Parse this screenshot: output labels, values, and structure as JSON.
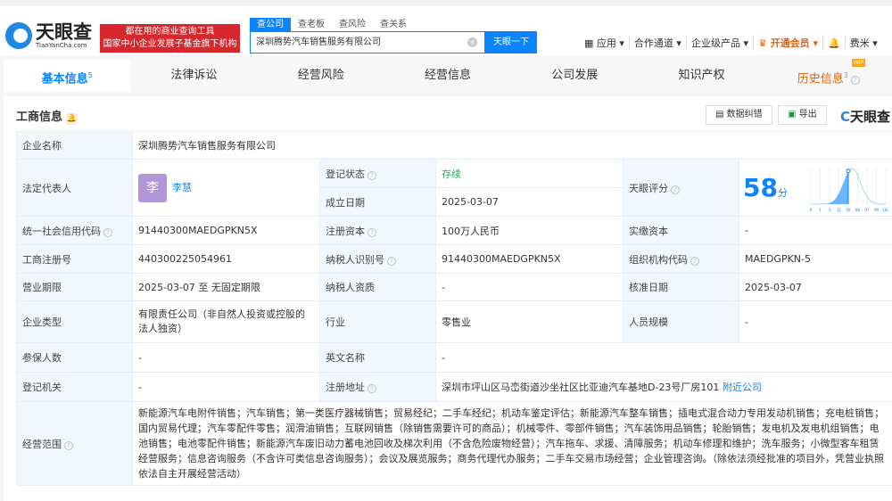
{
  "header": {
    "logo_cn": "天眼查",
    "logo_en": "TianYanCha.com",
    "slogan_1": "都在用的商业查询工具",
    "slogan_2": "国家中小企业发展子基金旗下机构",
    "search_tabs": [
      "查公司",
      "查老板",
      "查风险",
      "查关系"
    ],
    "search_value": "深圳腾势汽车销售服务有限公司",
    "search_button": "天眼一下",
    "nav": [
      "应用",
      "合作通道",
      "企业级产品",
      "开通会员",
      "费米"
    ]
  },
  "tabs": [
    {
      "label": "基本信息",
      "count": "5"
    },
    {
      "label": "法律诉讼"
    },
    {
      "label": "经营风险"
    },
    {
      "label": "经营信息"
    },
    {
      "label": "公司发展"
    },
    {
      "label": "知识产权"
    },
    {
      "label": "历史信息",
      "count": "3",
      "badge": "WIP"
    }
  ],
  "section": {
    "title": "工商信息",
    "report_error": "数据纠错",
    "export": "导出",
    "brand": "天眼查"
  },
  "info": {
    "company_name_label": "企业名称",
    "company_name": "深圳腾势汽车销售服务有限公司",
    "legal_rep_label": "法定代表人",
    "legal_rep_avatar": "李",
    "legal_rep": "李慧",
    "status_label": "登记状态",
    "status": "存续",
    "founded_label": "成立日期",
    "founded": "2025-03-07",
    "score_label": "天眼评分",
    "score": "58",
    "score_unit": "分",
    "credit_code_label": "统一社会信用代码",
    "credit_code": "91440300MAEDGPKN5X",
    "capital_label": "注册资本",
    "capital": "100万人民币",
    "paid_label": "实缴资本",
    "paid": "-",
    "reg_no_label": "工商注册号",
    "reg_no": "440300225054961",
    "taxpayer_id_label": "纳税人识别号",
    "taxpayer_id": "91440300MAEDGPKN5X",
    "org_code_label": "组织机构代码",
    "org_code": "MAEDGPKN-5",
    "term_label": "营业期限",
    "term": "2025-03-07 至 无固定期限",
    "taxpayer_qual_label": "纳税人资质",
    "taxpayer_qual": "-",
    "approve_label": "核准日期",
    "approve": "2025-03-07",
    "type_label": "企业类型",
    "type": "有限责任公司（非自然人投资或控股的法人独资）",
    "industry_label": "行业",
    "industry": "零售业",
    "staff_label": "人员规模",
    "staff": "-",
    "insured_label": "参保人数",
    "insured": "-",
    "en_name_label": "英文名称",
    "en_name": "-",
    "authority_label": "登记机关",
    "authority": "-",
    "address_label": "注册地址",
    "address": "深圳市坪山区马峦街道沙坐社区比亚迪汽车基地D-23号厂房101",
    "nearby": "附近公司",
    "scope_label": "经营范围",
    "scope": "新能源汽车电附件销售；汽车销售；第一类医疗器械销售；贸易经纪；二手车经纪；机动车鉴定评估；新能源汽车整车销售；插电式混合动力专用发动机销售；充电桩销售；国内贸易代理；汽车零配件零售；润滑油销售；互联网销售（除销售需要许可的商品）；机械零件、零部件销售；汽车装饰用品销售；轮胎销售；发电机及发电机组销售；电池销售；电池零配件销售；新能源汽车废旧动力蓄电池回收及梯次利用（不含危险废物经营）；汽车拖车、求援、清障服务；机动车修理和维护；洗车服务；小微型客车租赁经营服务；信息咨询服务（不含许可类信息咨询服务）；会议及展览服务；商务代理代办服务；二手车交易市场经营；企业管理咨询。（除依法须经批准的项目外，凭营业执照依法自主开展经营活动）"
  },
  "chart_data": {
    "type": "area",
    "x_ticks": [
      "0",
      "1",
      "3",
      "11",
      "50",
      "89",
      "97",
      "99",
      "100"
    ],
    "marker": 58,
    "color": "#0a84ff"
  }
}
